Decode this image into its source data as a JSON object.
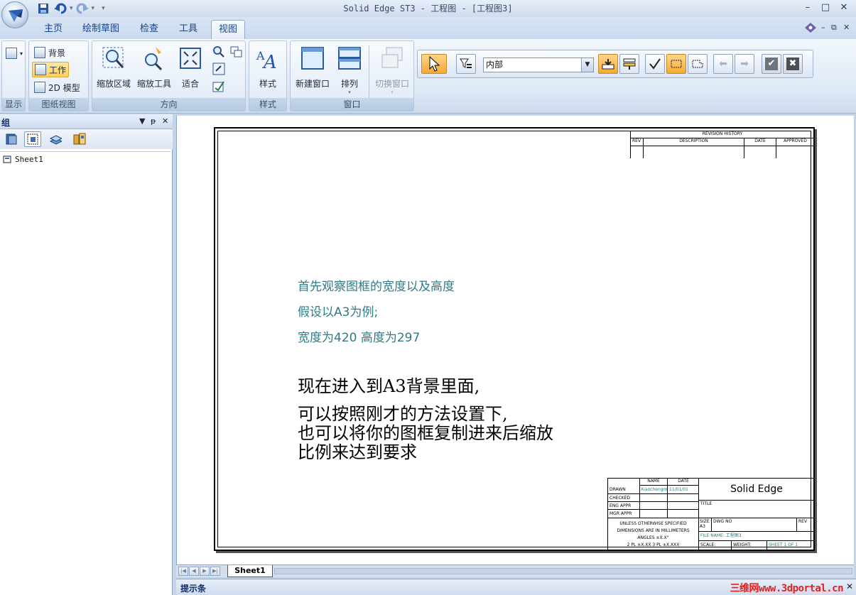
{
  "app": {
    "title": "Solid Edge ST3 - 工程图 - [工程图3]",
    "window_controls": [
      "–",
      "□",
      "✕"
    ],
    "mdi_controls": [
      "–",
      "⧉",
      "✕"
    ]
  },
  "qat": {
    "save_icon": "save-icon",
    "undo_icon": "undo-icon",
    "redo_icon": "redo-icon",
    "customize_icon": "customize-qat-icon"
  },
  "tabs": [
    {
      "label": "主页"
    },
    {
      "label": "绘制草图"
    },
    {
      "label": "检查"
    },
    {
      "label": "工具"
    },
    {
      "label": "视图",
      "active": true
    }
  ],
  "ribbon": {
    "display_group": {
      "label": "显示"
    },
    "sheet_view_group": {
      "label": "图纸视图",
      "items": [
        {
          "label": "背景"
        },
        {
          "label": "工作",
          "pressed": true
        },
        {
          "label": "2D 模型"
        }
      ]
    },
    "orientation_group": {
      "label": "方向",
      "zoom_area": "缩放区域",
      "zoom_tool": "缩放工具",
      "fit": "适合"
    },
    "style_group": {
      "label": "样式",
      "style": "样式"
    },
    "window_group": {
      "label": "窗口",
      "new_window": "新建窗口",
      "arrange": "排列",
      "switch_window": "切换窗口"
    }
  },
  "select_toolbar": {
    "filter_value": "内部"
  },
  "pane": {
    "title": "组",
    "controls": [
      "▼",
      "ᵽ",
      "✕"
    ],
    "tree_item": "Sheet1"
  },
  "drawing": {
    "revision": {
      "title": "REVISION HISTORY",
      "cols": [
        "REV",
        "DESCRIPTION",
        "DATE",
        "APPROVED"
      ]
    },
    "notes_teal": [
      "首先观察图框的宽度以及高度",
      "假设以A3为例;",
      "宽度为420 高度为297"
    ],
    "notes_black": [
      "现在进入到A3背景里面,",
      "可以按照刚才的方法设置下,",
      "也可以将你的图框复制进来后缩放",
      "比例来达到要求"
    ],
    "title_block": {
      "name_col": "NAME",
      "date_col": "DATE",
      "rows": [
        "DRAWN",
        "CHECKED",
        "ENG APPR",
        "MGR APPR"
      ],
      "drawn_name": "Xiaochengm",
      "drawn_date": "11/01/01",
      "company": "Solid Edge",
      "title_label": "TITLE",
      "unless_lines": [
        "UNLESS OTHERWISE SPECIFIED",
        "DIMENSIONS ARE IN MILLIMETERS",
        "ANGLES ±X.X°",
        "2 PL ±X.XX 3 PL ±X.XXX"
      ],
      "size_label": "SIZE",
      "size_value": "A3",
      "dwg_no_label": "DWG NO",
      "rev_label": "REV",
      "file_name": "FILE NAME: 工程图3",
      "scale": "SCALE:",
      "weight": "WEIGHT:",
      "sheet": "SHEET 1 OF 1"
    }
  },
  "sheet_tab": "Sheet1",
  "prompt_bar": {
    "title": "提示条",
    "watermark": "三维网www.3dportal.cn"
  }
}
